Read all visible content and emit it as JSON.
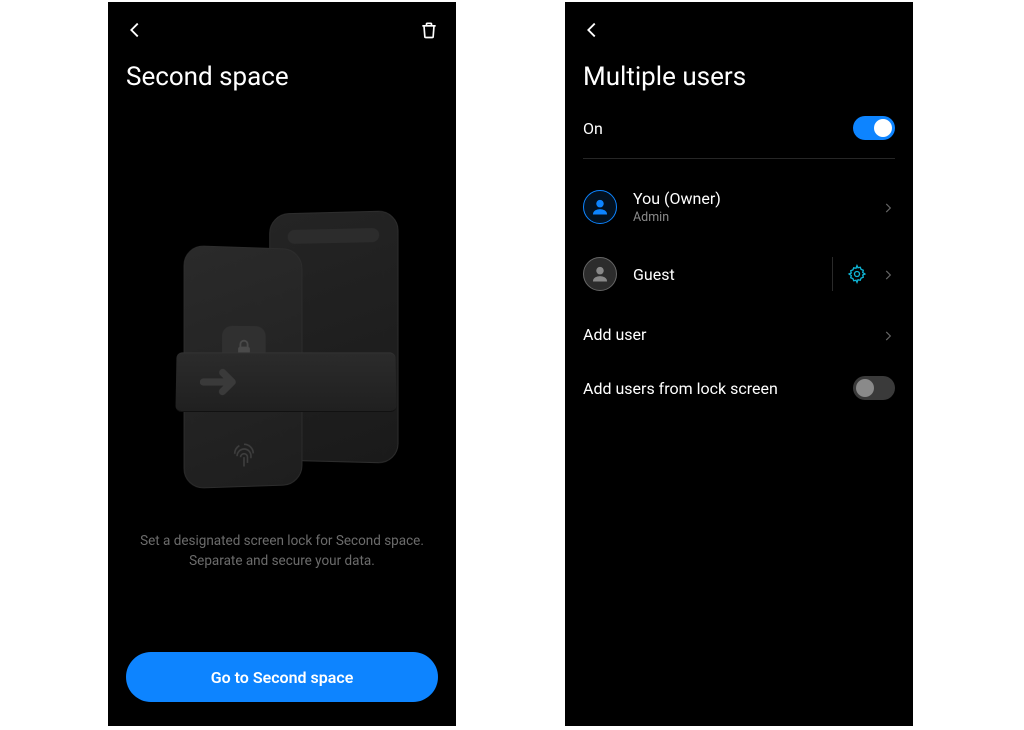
{
  "left": {
    "title": "Second space",
    "description_line1": "Set a designated screen lock for Second space.",
    "description_line2": "Separate and secure your data.",
    "cta_label": "Go to Second space"
  },
  "right": {
    "title": "Multiple users",
    "toggle_label": "On",
    "toggle_state": "on",
    "users": [
      {
        "name": "You (Owner)",
        "role": "Admin",
        "type": "owner"
      },
      {
        "name": "Guest",
        "role": "",
        "type": "guest"
      }
    ],
    "add_user_label": "Add user",
    "lock_screen_label": "Add users from lock screen",
    "lock_screen_toggle_state": "off"
  },
  "colors": {
    "accent": "#0d84ff",
    "gear_accent": "#0fb6d6"
  }
}
